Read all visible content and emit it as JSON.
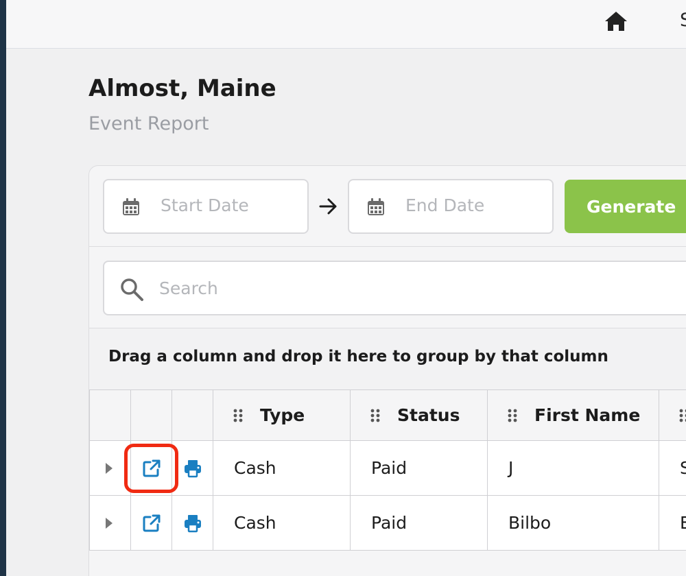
{
  "topbar": {
    "partial_label": "S"
  },
  "page": {
    "title": "Almost, Maine",
    "subtitle": "Event Report"
  },
  "filters": {
    "start_placeholder": "Start Date",
    "end_placeholder": "End Date",
    "generate_label": "Generate"
  },
  "search": {
    "placeholder": "Search"
  },
  "grouping": {
    "hint": "Drag a column and drop it here to group by that column"
  },
  "table": {
    "columns": [
      "Type",
      "Status",
      "First Name"
    ],
    "rows": [
      {
        "type": "Cash",
        "status": "Paid",
        "first_name": "J",
        "next_col": "S"
      },
      {
        "type": "Cash",
        "status": "Paid",
        "first_name": "Bilbo",
        "next_col": "E"
      }
    ]
  },
  "colors": {
    "accent_green": "#8bc34a",
    "icon_blue": "#1a7fc1",
    "highlight_red": "#f02a12"
  }
}
